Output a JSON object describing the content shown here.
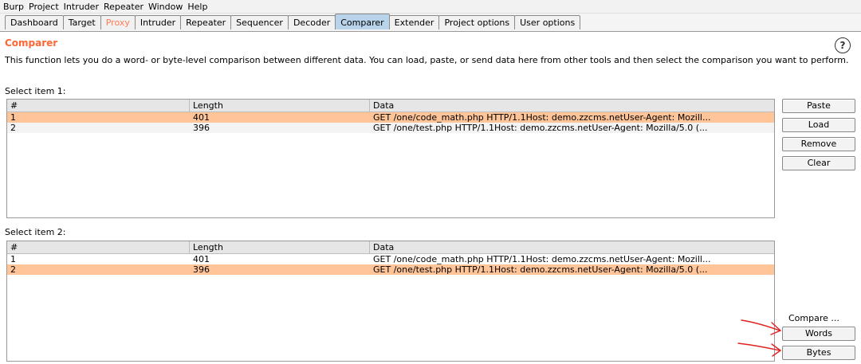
{
  "menu": [
    "Burp",
    "Project",
    "Intruder",
    "Repeater",
    "Window",
    "Help"
  ],
  "tabs": [
    "Dashboard",
    "Target",
    "Proxy",
    "Intruder",
    "Repeater",
    "Sequencer",
    "Decoder",
    "Comparer",
    "Extender",
    "Project options",
    "User options"
  ],
  "active_tab": "Comparer",
  "section": {
    "title": "Comparer",
    "help_icon": "?",
    "description": "This function lets you do a word- or byte-level comparison between different data. You can load, paste, or send data here from other tools and then select the comparison you want to perform."
  },
  "item1": {
    "label": "Select item 1:",
    "columns": [
      "#",
      "Length",
      "Data"
    ],
    "rows": [
      {
        "num": "1",
        "length": "401",
        "data": "GET /one/code_math.php HTTP/1.1Host: demo.zzcms.netUser-Agent: Mozill...",
        "selected": true
      },
      {
        "num": "2",
        "length": "396",
        "data": "GET /one/test.php HTTP/1.1Host: demo.zzcms.netUser-Agent: Mozilla/5.0 (...",
        "selected": false
      }
    ]
  },
  "item2": {
    "label": "Select item 2:",
    "columns": [
      "#",
      "Length",
      "Data"
    ],
    "rows": [
      {
        "num": "1",
        "length": "401",
        "data": "GET /one/code_math.php HTTP/1.1Host: demo.zzcms.netUser-Agent: Mozill...",
        "selected": false
      },
      {
        "num": "2",
        "length": "396",
        "data": "GET /one/test.php HTTP/1.1Host: demo.zzcms.netUser-Agent: Mozilla/5.0 (...",
        "selected": true
      }
    ]
  },
  "buttons": {
    "paste": "Paste",
    "load": "Load",
    "remove": "Remove",
    "clear": "Clear",
    "compare_label": "Compare ...",
    "words": "Words",
    "bytes": "Bytes"
  },
  "colors": {
    "accent": "#ff6633",
    "selected_row": "#ffc599",
    "active_tab": "#b9d3ea",
    "annotation": "#e02020"
  }
}
